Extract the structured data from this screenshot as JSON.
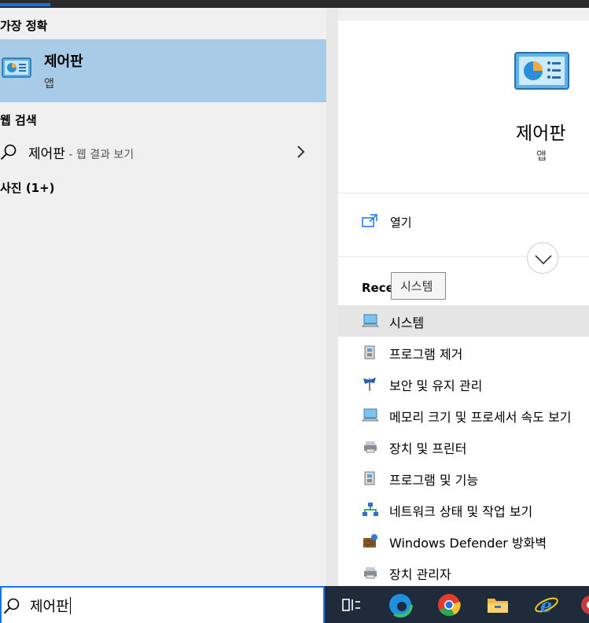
{
  "left": {
    "best_match_title": "가장 정확",
    "best_match": {
      "name": "제어판",
      "type": "앱"
    },
    "web_title": "웹 검색",
    "web_result": {
      "query": "제어판",
      "hint": " - 웹 결과 보기"
    },
    "photos_title": "사진 (1+)"
  },
  "search": {
    "value": "제어판"
  },
  "detail": {
    "title": "제어판",
    "type": "앱",
    "open_label": "열기",
    "recent_title": "Rece",
    "tooltip": "시스템",
    "recent_items": [
      {
        "label": "시스템",
        "icon": "system-icon"
      },
      {
        "label": "프로그램 제거",
        "icon": "programs-icon"
      },
      {
        "label": "보안 및 유지 관리",
        "icon": "flag-icon"
      },
      {
        "label": "메모리 크기 및 프로세서 속도 보기",
        "icon": "system-icon"
      },
      {
        "label": "장치 및 프린터",
        "icon": "printer-icon"
      },
      {
        "label": "프로그램 및 기능",
        "icon": "programs-icon"
      },
      {
        "label": "네트워크 상태 및 작업 보기",
        "icon": "network-icon"
      },
      {
        "label": "Windows Defender 방화벽",
        "icon": "firewall-icon"
      },
      {
        "label": "장치 관리자",
        "icon": "printer-icon"
      }
    ]
  },
  "taskbar": {
    "items": [
      "task-view-icon",
      "edge-icon",
      "chrome-icon",
      "file-explorer-icon",
      "ie-icon"
    ]
  },
  "colors": {
    "accent": "#1a73e8",
    "selected": "#a8cbe8"
  }
}
